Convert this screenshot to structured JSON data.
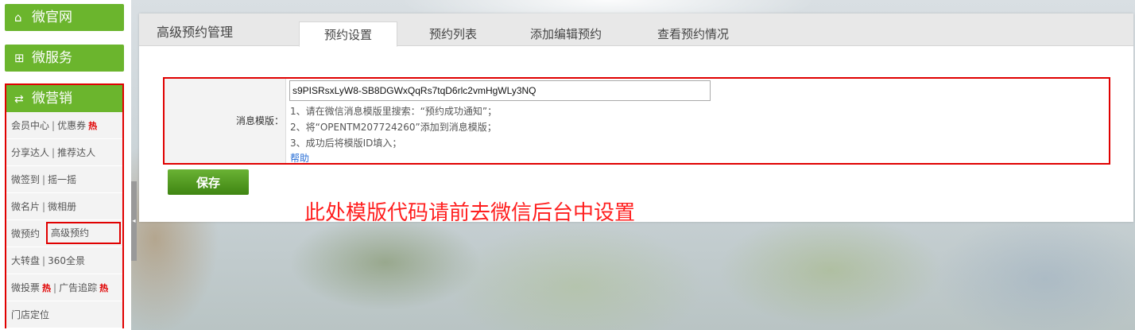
{
  "sidebar": {
    "wei_site": {
      "icon": "home-icon",
      "label": "微官网"
    },
    "wei_service": {
      "icon": "grid-icon",
      "label": "微服务"
    },
    "marketing": {
      "icon": "marketing-icon",
      "label": "微营销",
      "rows": [
        {
          "left": "会员中心",
          "right": "优惠券",
          "right_hot": "热"
        },
        {
          "left": "分享达人",
          "right": "推荐达人"
        },
        {
          "left": "微签到",
          "right": "摇一摇"
        },
        {
          "left": "微名片",
          "right": "微相册"
        },
        {
          "left": "微预约",
          "right": "高级预约"
        },
        {
          "left": "大转盘",
          "right": "360全景"
        },
        {
          "left": "微投票",
          "left_hot": "热",
          "right": "广告追踪",
          "right_hot": "热"
        },
        {
          "left": "门店定位"
        }
      ],
      "separator": "|"
    }
  },
  "panel": {
    "title": "高级预约管理",
    "tabs": [
      "预约设置",
      "预约列表",
      "添加编辑预约",
      "查看预约情况"
    ],
    "active_tab": 0
  },
  "form": {
    "label": "消息模版：",
    "template_value": "s9PISRsxLyW8-SB8DGWxQqRs7tqD6rlc2vmHgWLy3NQ",
    "hints": [
      "1、请在微信消息模版里搜索：“预约成功通知”；",
      "2、将“OPENTM207724260”添加到消息模版；",
      "3、成功后将模版ID填入；"
    ],
    "help": "帮助",
    "save": "保存"
  },
  "notice": "此处模版代码请前去微信后台中设置",
  "colors": {
    "green": "#6bb52d",
    "red_highlight": "#e00000",
    "notice": "#ff1f1f"
  }
}
